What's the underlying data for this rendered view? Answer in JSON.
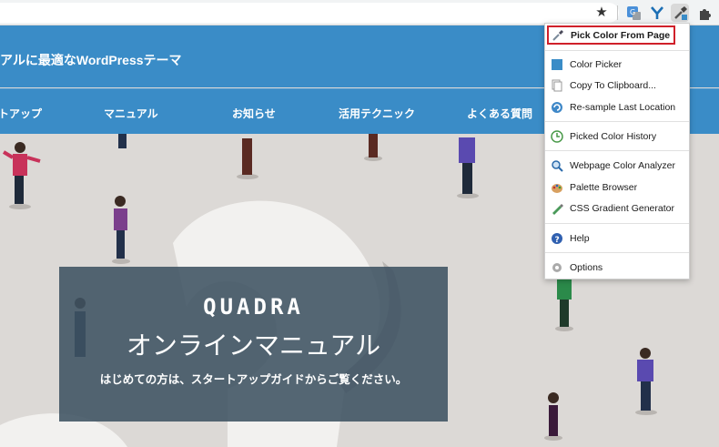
{
  "site": {
    "title": "アルに最適なWordPressテーマ",
    "nav": [
      "トアップ",
      "マニュアル",
      "お知らせ",
      "活用テクニック",
      "よくある質問"
    ]
  },
  "hero": {
    "logo": "QUADRA",
    "title": "オンラインマニュアル",
    "subtitle": "はじめての方は、スタートアップガイドからご覧ください。"
  },
  "popup": {
    "items": [
      {
        "label": "Pick Color From Page",
        "icon": "eyedropper-icon"
      },
      {
        "label": "Color Picker",
        "icon": "color-swatch-icon"
      },
      {
        "label": "Copy To Clipboard...",
        "icon": "clipboard-icon"
      },
      {
        "label": "Re-sample Last Location",
        "icon": "refresh-icon"
      },
      {
        "label": "Picked Color History",
        "icon": "history-icon"
      },
      {
        "label": "Webpage Color Analyzer",
        "icon": "magnifier-icon"
      },
      {
        "label": "Palette Browser",
        "icon": "palette-icon"
      },
      {
        "label": "CSS Gradient Generator",
        "icon": "pen-icon"
      },
      {
        "label": "Help",
        "icon": "help-icon"
      },
      {
        "label": "Options",
        "icon": "gear-icon"
      }
    ]
  },
  "colors": {
    "brand_blue": "#3a8cc7",
    "hero_overlay": "#3e5262",
    "highlight_red": "#d0202a"
  }
}
